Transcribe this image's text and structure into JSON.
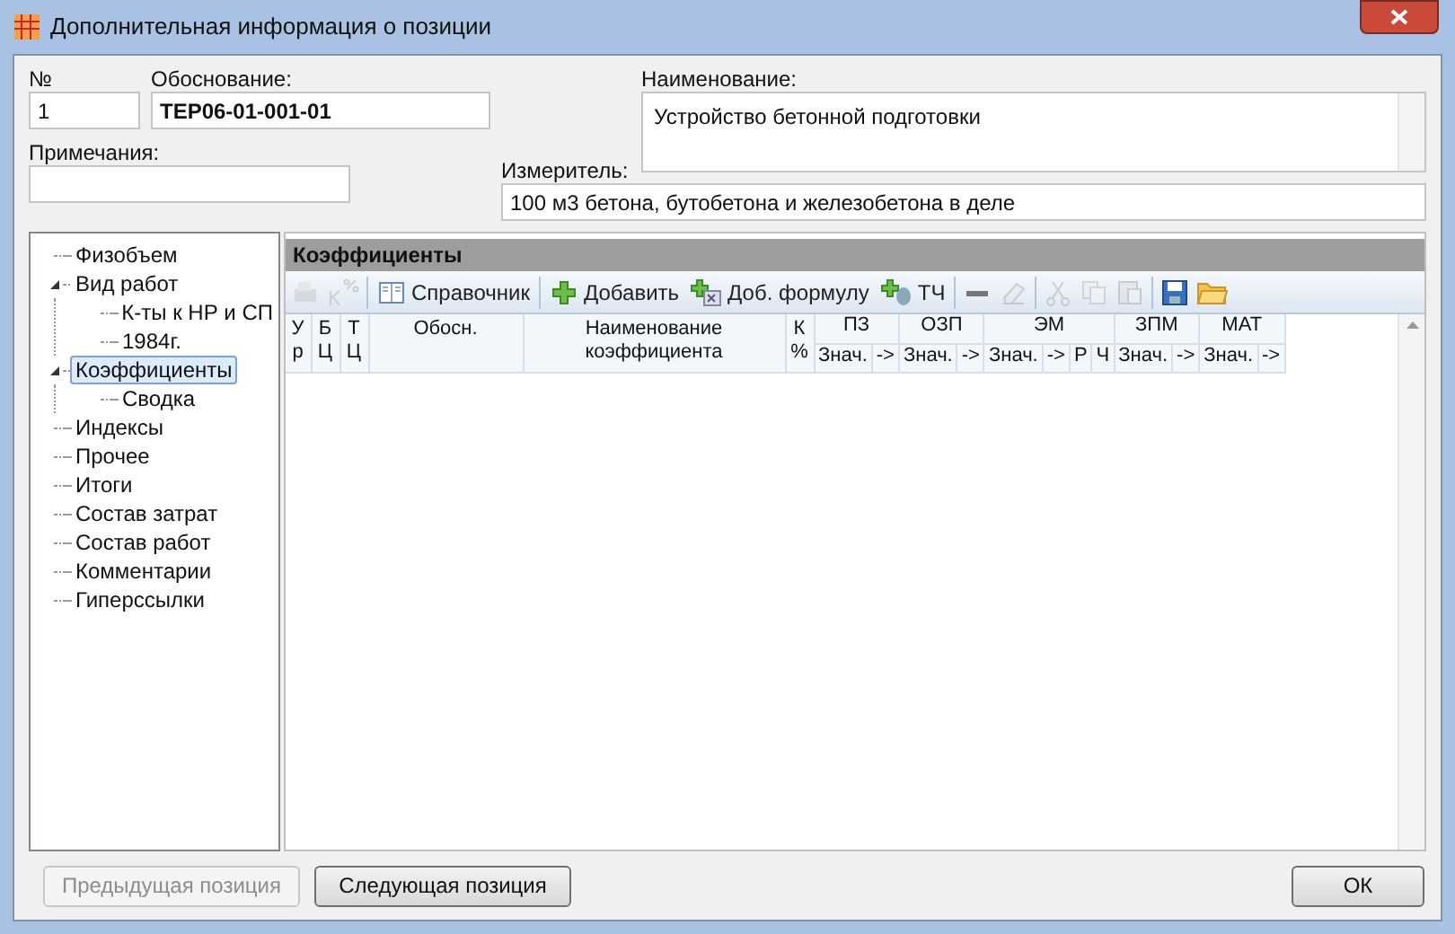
{
  "window": {
    "title": "Дополнительная информация о позиции"
  },
  "fields": {
    "number": {
      "label": "№",
      "value": "1"
    },
    "basis": {
      "label": "Обоснование:",
      "value": "ТЕР06-01-001-01"
    },
    "name": {
      "label": "Наименование:",
      "value": "Устройство бетонной подготовки"
    },
    "notes": {
      "label": "Примечания:"
    },
    "unit": {
      "label": "Измеритель:",
      "value": "100 м3 бетона, бутобетона и железобетона в деле"
    }
  },
  "tree": [
    {
      "label": "Физобъем",
      "selected": false
    },
    {
      "label": "Вид работ",
      "selected": false,
      "expanded": true,
      "children": [
        {
          "label": "К-ты к НР и СП",
          "selected": false
        },
        {
          "label": "1984г.",
          "selected": false
        }
      ]
    },
    {
      "label": "Коэффициенты",
      "selected": true,
      "expanded": true,
      "children": [
        {
          "label": "Сводка",
          "selected": false
        }
      ]
    },
    {
      "label": "Индексы",
      "selected": false
    },
    {
      "label": "Прочее",
      "selected": false
    },
    {
      "label": "Итоги",
      "selected": false
    },
    {
      "label": "Состав затрат",
      "selected": false
    },
    {
      "label": "Состав работ",
      "selected": false
    },
    {
      "label": "Комментарии",
      "selected": false
    },
    {
      "label": "Гиперссылки",
      "selected": false
    }
  ],
  "panel": {
    "title": "Коэффициенты",
    "toolbar": [
      {
        "kind": "icon",
        "disabled": true
      },
      {
        "kind": "icon",
        "disabled": true
      },
      {
        "kind": "separator"
      },
      {
        "kind": "button",
        "label": "Справочник",
        "disabled": false
      },
      {
        "kind": "separator"
      },
      {
        "kind": "button",
        "label": "Добавить",
        "disabled": false
      },
      {
        "kind": "button",
        "label": "Доб. формулу",
        "disabled": false
      },
      {
        "kind": "button",
        "label": "ТЧ",
        "disabled": false
      },
      {
        "kind": "separator"
      },
      {
        "kind": "icon",
        "disabled": false
      },
      {
        "kind": "icon",
        "disabled": true
      },
      {
        "kind": "separator"
      },
      {
        "kind": "icon",
        "disabled": true
      },
      {
        "kind": "icon",
        "disabled": true
      },
      {
        "kind": "icon",
        "disabled": true
      },
      {
        "kind": "separator"
      },
      {
        "kind": "icon",
        "disabled": false
      },
      {
        "kind": "icon",
        "disabled": false
      }
    ],
    "columns": [
      {
        "label": "У р"
      },
      {
        "label": "Б Ц"
      },
      {
        "label": "Т Ц"
      },
      {
        "label": "Обосн."
      },
      {
        "label": "Наименование коэффициента"
      },
      {
        "label": "К %"
      },
      {
        "label": "ПЗ",
        "sub": [
          "Знач.",
          "->"
        ]
      },
      {
        "label": "ОЗП",
        "sub": [
          "Знач.",
          "->"
        ]
      },
      {
        "label": "ЭМ",
        "sub": [
          "Знач.",
          "->",
          "Р",
          "Ч"
        ]
      },
      {
        "label": "ЗПМ",
        "sub": [
          "Знач.",
          "->"
        ]
      },
      {
        "label": "МАТ",
        "sub": [
          "Знач.",
          "->"
        ]
      }
    ]
  },
  "buttons": [
    {
      "label": "Предыдущая позиция",
      "disabled": true
    },
    {
      "label": "Следующая позиция",
      "disabled": false
    },
    {
      "label": "ОК",
      "disabled": false
    }
  ]
}
